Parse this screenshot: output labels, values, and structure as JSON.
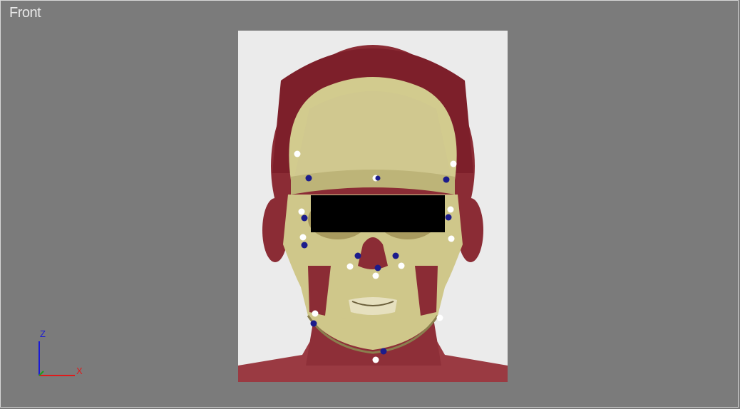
{
  "viewport": {
    "label": "Front"
  },
  "axis_gizmo": {
    "z_label": "Z",
    "x_label": "X",
    "colors": {
      "z": "#1a1ad6",
      "x": "#e01a1a",
      "y": "#1aa01a"
    }
  },
  "scene": {
    "description_icon": "skull-overlay-model",
    "colors": {
      "skin": "#8c2a33",
      "skull": "#cfc78a",
      "marker_white": "#ffffff",
      "marker_blue": "#1c1c8c",
      "redaction": "#000000"
    }
  }
}
